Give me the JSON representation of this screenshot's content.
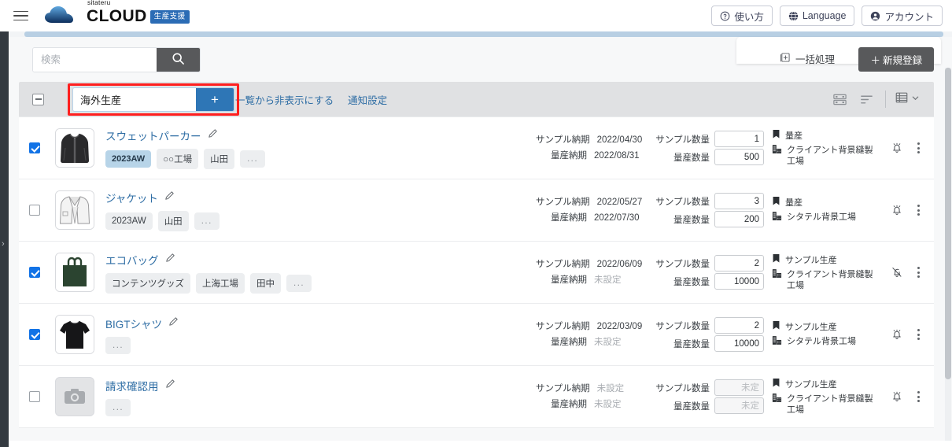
{
  "header": {
    "menu_icon": "hamburger-icon",
    "brand_sub": "sitateru",
    "brand_main": "CLOUD",
    "brand_badge": "生産支援",
    "buttons": [
      {
        "label": "使い方",
        "icon": "question-circle-icon"
      },
      {
        "label": "Language",
        "icon": "globe-icon"
      },
      {
        "label": "アカウント",
        "icon": "account-circle-icon"
      }
    ]
  },
  "search": {
    "placeholder": "検索",
    "value": "",
    "button_icon": "search-icon"
  },
  "actions": {
    "bulk_label": "一括処理",
    "bulk_icon": "bulk-process-icon",
    "new_label": "新規登録",
    "new_prefix": "＋"
  },
  "toolbar": {
    "collapse_icon": "minus-box-icon",
    "tag_input_value": "海外生産",
    "tag_add_label": "+",
    "link_hide": "一覧から非表示にする",
    "link_notify": "通知設定",
    "icons": [
      {
        "name": "card-view-icon"
      },
      {
        "name": "sort-icon"
      },
      {
        "name": "table-view-icon"
      },
      {
        "name": "chevron-down-icon"
      }
    ]
  },
  "labels": {
    "sample_due": "サンプル納期",
    "mass_due": "量産納期",
    "sample_qty": "サンプル数量",
    "mass_qty": "量産数量",
    "unset": "未設定",
    "undecided": "未定"
  },
  "rows": [
    {
      "checked": true,
      "thumb": "hoodie",
      "name": "スウェットパーカー",
      "edit_icon": "pencil-icon",
      "tags": [
        {
          "label": "2023AW",
          "type": "season"
        },
        {
          "label": "○○工場",
          "type": "normal"
        },
        {
          "label": "山田",
          "type": "normal"
        },
        {
          "label": "...",
          "type": "more"
        }
      ],
      "sample_due": "2022/04/30",
      "sample_due_unset": false,
      "mass_due": "2022/08/31",
      "mass_due_unset": false,
      "sample_qty": "1",
      "mass_qty": "500",
      "qty_disabled": false,
      "stage": "量産",
      "stage_icon": "bookmark-icon",
      "factory": "クライアント背景縫製工場",
      "factory_icon": "factory-icon",
      "bell": "bell-icon"
    },
    {
      "checked": false,
      "thumb": "jacket",
      "name": "ジャケット",
      "edit_icon": "pencil-icon",
      "tags": [
        {
          "label": "2023AW",
          "type": "normal"
        },
        {
          "label": "山田",
          "type": "normal"
        },
        {
          "label": "...",
          "type": "more"
        }
      ],
      "sample_due": "2022/05/27",
      "sample_due_unset": false,
      "mass_due": "2022/07/30",
      "mass_due_unset": false,
      "sample_qty": "3",
      "mass_qty": "200",
      "qty_disabled": false,
      "stage": "量産",
      "stage_icon": "bookmark-icon",
      "factory": "シタテル背景工場",
      "factory_icon": "factory-icon",
      "bell": "bell-icon"
    },
    {
      "checked": true,
      "thumb": "ecobag",
      "name": "エコバッグ",
      "edit_icon": "pencil-icon",
      "tags": [
        {
          "label": "コンテンツグッズ",
          "type": "normal"
        },
        {
          "label": "上海工場",
          "type": "normal"
        },
        {
          "label": "田中",
          "type": "normal"
        },
        {
          "label": "...",
          "type": "more"
        }
      ],
      "sample_due": "2022/06/09",
      "sample_due_unset": false,
      "mass_due": "未設定",
      "mass_due_unset": true,
      "sample_qty": "2",
      "mass_qty": "10000",
      "qty_disabled": false,
      "stage": "サンプル生産",
      "stage_icon": "bookmark-icon",
      "factory": "クライアント背景縫製工場",
      "factory_icon": "factory-icon",
      "bell": "bell-off-icon"
    },
    {
      "checked": true,
      "thumb": "tshirt",
      "name": "BIGTシャツ",
      "edit_icon": "pencil-icon",
      "tags": [
        {
          "label": "...",
          "type": "more"
        }
      ],
      "sample_due": "2022/03/09",
      "sample_due_unset": false,
      "mass_due": "未設定",
      "mass_due_unset": true,
      "sample_qty": "2",
      "mass_qty": "10000",
      "qty_disabled": false,
      "stage": "サンプル生産",
      "stage_icon": "bookmark-icon",
      "factory": "シタテル背景工場",
      "factory_icon": "factory-icon",
      "bell": "bell-icon"
    },
    {
      "checked": false,
      "thumb": "placeholder",
      "name": "請求確認用",
      "edit_icon": "pencil-icon",
      "tags": [
        {
          "label": "...",
          "type": "more"
        }
      ],
      "sample_due": "未設定",
      "sample_due_unset": true,
      "mass_due": "未設定",
      "mass_due_unset": true,
      "sample_qty": "",
      "mass_qty": "",
      "qty_disabled": true,
      "stage": "サンプル生産",
      "stage_icon": "bookmark-icon",
      "factory": "クライアント背景縫製工場",
      "factory_icon": "factory-icon",
      "bell": "bell-icon"
    }
  ],
  "colors": {
    "accent_blue": "#2e6da4",
    "tag_blue": "#2e76b6",
    "highlight_red": "#ff1f1f",
    "dark_button": "#58595b",
    "season_tag": "#b7d4e8"
  }
}
